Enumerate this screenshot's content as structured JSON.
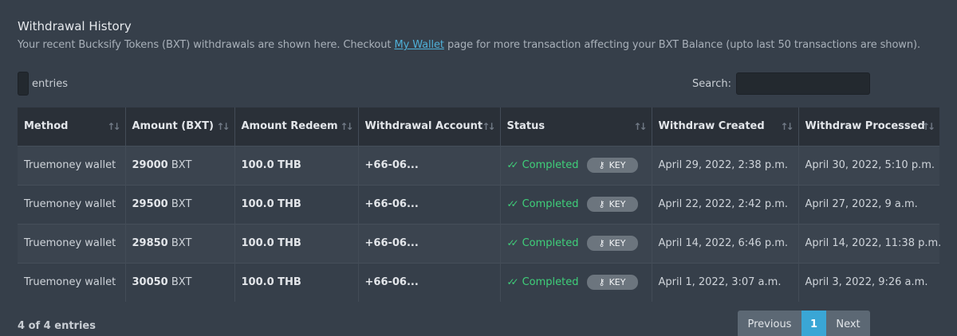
{
  "header": {
    "title": "Withdrawal History",
    "subtitle_before": "Your recent Bucksify Tokens (BXT) withdrawals are shown here. Checkout ",
    "subtitle_link": "My Wallet",
    "subtitle_after": " page for more transaction affecting your BXT Balance (upto last 50 transactions are shown)."
  },
  "controls": {
    "entries_label": "entries",
    "search_label": "Search:",
    "search_value": ""
  },
  "table": {
    "columns": [
      "Method",
      "Amount (BXT)",
      "Amount Redeem",
      "Withdrawal Account",
      "Status",
      "Withdraw Created",
      "Withdraw Processed"
    ],
    "rows": [
      {
        "method": "Truemoney wallet",
        "amount": "29000",
        "unit": "BXT",
        "redeem": "100.0 THB",
        "account": "+66-06...",
        "status": "Completed",
        "key": "KEY",
        "created": "April 29, 2022, 2:38 p.m.",
        "processed": "April 30, 2022, 5:10 p.m."
      },
      {
        "method": "Truemoney wallet",
        "amount": "29500",
        "unit": "BXT",
        "redeem": "100.0 THB",
        "account": "+66-06...",
        "status": "Completed",
        "key": "KEY",
        "created": "April 22, 2022, 2:42 p.m.",
        "processed": "April 27, 2022, 9 a.m."
      },
      {
        "method": "Truemoney wallet",
        "amount": "29850",
        "unit": "BXT",
        "redeem": "100.0 THB",
        "account": "+66-06...",
        "status": "Completed",
        "key": "KEY",
        "created": "April 14, 2022, 6:46 p.m.",
        "processed": "April 14, 2022, 11:38 p.m."
      },
      {
        "method": "Truemoney wallet",
        "amount": "30050",
        "unit": "BXT",
        "redeem": "100.0 THB",
        "account": "+66-06...",
        "status": "Completed",
        "key": "KEY",
        "created": "April 1, 2022, 3:07 a.m.",
        "processed": "April 3, 2022, 9:26 a.m."
      }
    ]
  },
  "footer": {
    "info": "4 of 4 entries",
    "prev": "Previous",
    "page": "1",
    "next": "Next"
  },
  "icons": {
    "sort": "sort-arrows-icon",
    "check": "double-check-icon",
    "key": "key-icon"
  },
  "colors": {
    "background": "#363f4a",
    "header_bg": "#2a3038",
    "link": "#4fb0d8",
    "status_green": "#3fd07a",
    "active_page": "#3aa6d5"
  }
}
